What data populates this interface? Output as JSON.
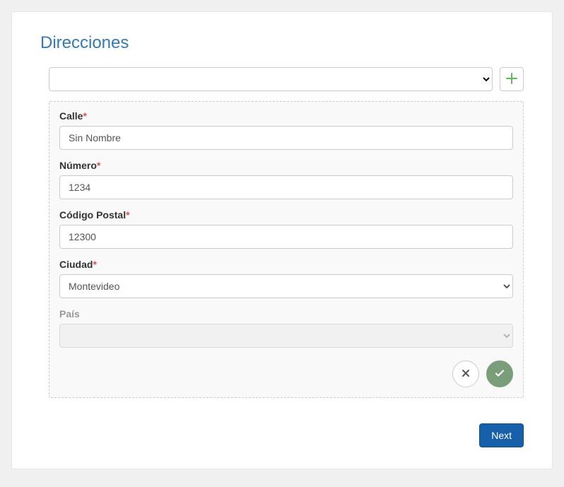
{
  "section": {
    "title": "Direcciones"
  },
  "top_select": {
    "value": ""
  },
  "form": {
    "street": {
      "label": "Calle",
      "required": true,
      "value": "Sin Nombre"
    },
    "number": {
      "label": "Número",
      "required": true,
      "value": "1234"
    },
    "postal": {
      "label": "Código Postal",
      "required": true,
      "value": "12300"
    },
    "city": {
      "label": "Ciudad",
      "required": true,
      "value": "Montevideo"
    },
    "country": {
      "label": "País",
      "required": false,
      "value": ""
    }
  },
  "footer": {
    "next": "Next"
  },
  "required_marker": "*"
}
